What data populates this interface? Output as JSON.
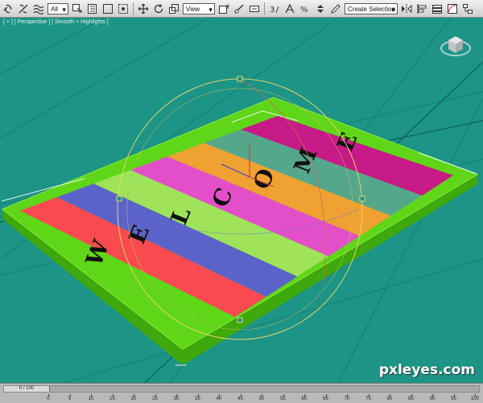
{
  "toolbar": {
    "filter_value": "All",
    "coord_value": "View",
    "named_selection_value": "Create Selection Se",
    "icons": [
      "link-icon",
      "unlink-icon",
      "bind-spacewarp-icon",
      "select-object-icon",
      "select-by-name-icon",
      "rect-region-icon",
      "window-crossing-icon",
      "move-icon",
      "rotate-icon",
      "scale-icon",
      "pivot-icon",
      "manipulate-icon",
      "snap-3d-icon",
      "angle-snap-icon",
      "percent-snap-icon",
      "spinner-snap-icon",
      "edit-named-sel-icon",
      "mirror-icon",
      "align-icon",
      "layer-icon",
      "curve-editor-icon",
      "schematic-icon"
    ]
  },
  "viewport": {
    "label": "[ + ] [ Perspective ] [ Smooth + Highlights ]",
    "background": "#1c9486",
    "mat_text": "WELCOME",
    "stripe_colors": [
      "#f94b4f",
      "#5b63c8",
      "#9ee35a",
      "#e34fc9",
      "#efa232",
      "#55a78c",
      "#c61a86"
    ],
    "frame_color": "#5fd617",
    "viewcube_icon": "viewcube-icon"
  },
  "timeline": {
    "frame_readout": "0 / 100",
    "ticks": [
      "0",
      "5",
      "10",
      "15",
      "20",
      "25",
      "30",
      "35",
      "40",
      "45",
      "50",
      "55",
      "60",
      "65",
      "70",
      "75",
      "80",
      "85",
      "90",
      "95",
      "100"
    ]
  },
  "watermark": "pxleyes.com"
}
